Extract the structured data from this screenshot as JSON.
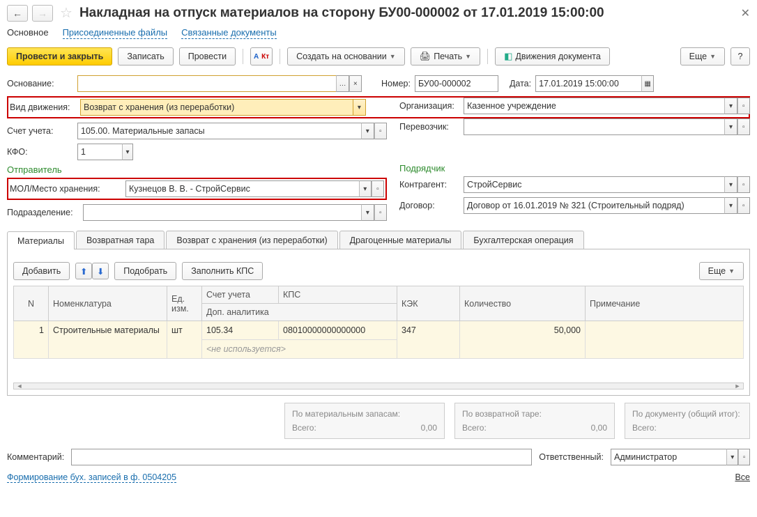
{
  "title": "Накладная на отпуск материалов на сторону БУ00-000002 от 17.01.2019 15:00:00",
  "nav": {
    "main": "Основное",
    "files": "Присоединенные файлы",
    "linked": "Связанные документы"
  },
  "toolbar": {
    "post_close": "Провести и закрыть",
    "save": "Записать",
    "post": "Провести",
    "create_from": "Создать на основании",
    "print": "Печать",
    "movements": "Движения документа",
    "more": "Еще",
    "help": "?"
  },
  "labels": {
    "basis": "Основание:",
    "number": "Номер:",
    "date": "Дата:",
    "move_type": "Вид движения:",
    "org": "Организация:",
    "account": "Счет учета:",
    "carrier": "Перевозчик:",
    "kfo": "КФО:",
    "sender": "Отправитель",
    "contractor_sec": "Подрядчик",
    "mol": "МОЛ/Место хранения:",
    "counterparty": "Контрагент:",
    "department": "Подразделение:",
    "contract": "Договор:",
    "comment": "Комментарий:",
    "responsible": "Ответственный:"
  },
  "values": {
    "basis": "",
    "number": "БУ00-000002",
    "date": "17.01.2019 15:00:00",
    "move_type": "Возврат с хранения (из переработки)",
    "org": "Казенное учреждение",
    "account": "105.00. Материальные запасы",
    "carrier": "",
    "kfo": "1",
    "mol": "Кузнецов В. В. - СтройСервис",
    "counterparty": "СтройСервис",
    "department": "",
    "contract": "Договор от 16.01.2019 № 321 (Строительный подряд)",
    "comment": "",
    "responsible": "Администратор"
  },
  "tabs": {
    "materials": "Материалы",
    "tare": "Возвратная тара",
    "return": "Возврат с хранения (из переработки)",
    "precious": "Драгоценные материалы",
    "accounting": "Бухгалтерская операция"
  },
  "sub_toolbar": {
    "add": "Добавить",
    "pick": "Подобрать",
    "fill_kps": "Заполнить КПС",
    "more": "Еще"
  },
  "grid": {
    "cols": {
      "n": "N",
      "nomen": "Номенклатура",
      "unit": "Ед. изм.",
      "account": "Счет учета",
      "kps": "КПС",
      "kek": "КЭК",
      "qty": "Количество",
      "note": "Примечание",
      "extra": "Доп. аналитика",
      "unused": "<не используется>"
    },
    "rows": [
      {
        "n": "1",
        "nomen": "Строительные материалы",
        "unit": "шт",
        "account": "105.34",
        "kps": "08010000000000000",
        "kek": "347",
        "qty": "50,000",
        "note": ""
      }
    ]
  },
  "summary": {
    "mat_title": "По материальным запасам:",
    "tare_title": "По возвратной таре:",
    "doc_title": "По документу (общий итог):",
    "total_label": "Всего:",
    "mat_val": "0,00",
    "tare_val": "0,00",
    "doc_val": ""
  },
  "link_form": "Формирование бух. записей в ф. 0504205",
  "all": "Все"
}
